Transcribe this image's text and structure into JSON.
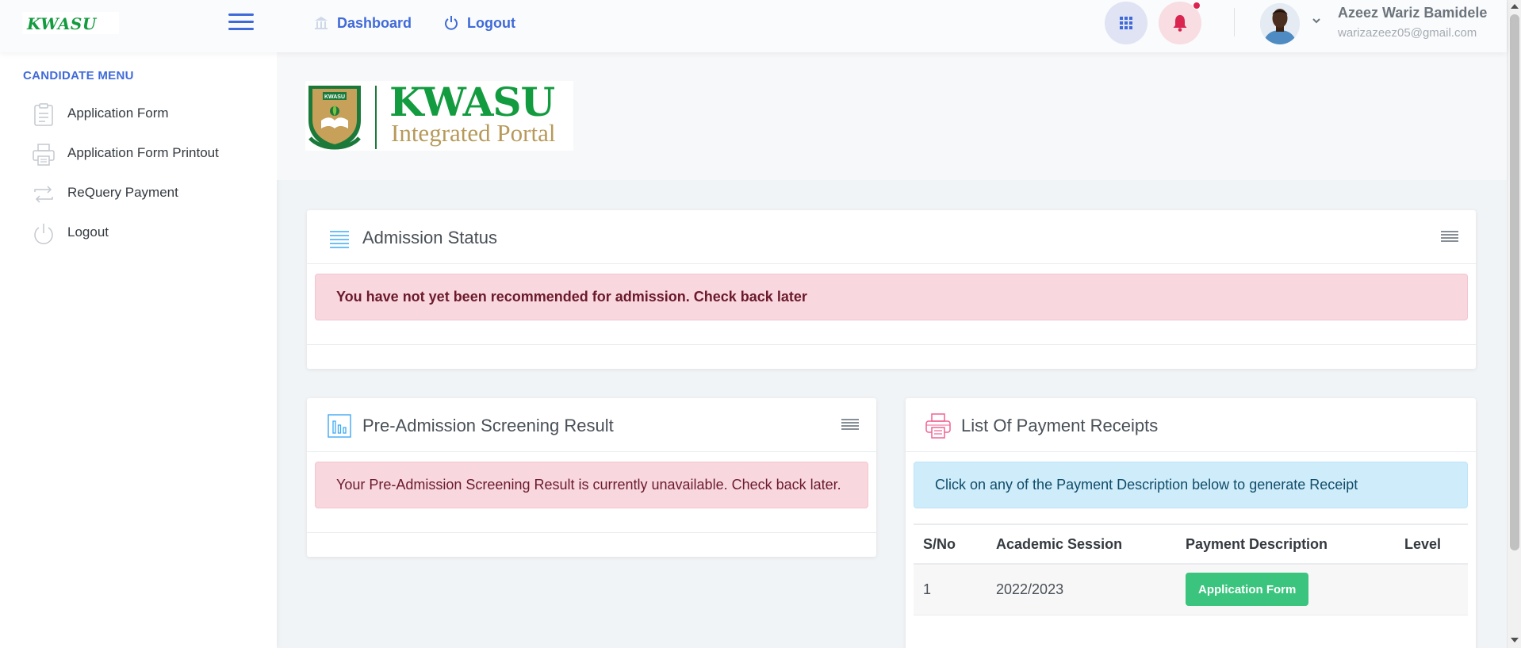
{
  "header": {
    "logo_text": "KWASU",
    "nav": [
      {
        "label": "Dashboard",
        "icon": "bank-icon"
      },
      {
        "label": "Logout",
        "icon": "power-icon"
      }
    ],
    "user": {
      "name": "Azeez Wariz Bamidele",
      "email": "warizazeez05@gmail.com"
    },
    "icons": [
      "hamburger-icon",
      "apps-grid-icon",
      "bell-icon",
      "chevron-down-icon"
    ],
    "accent_color": "#3f6ad8",
    "notification_color": "#d92550"
  },
  "sidebar": {
    "heading": "CANDIDATE MENU",
    "items": [
      {
        "label": "Application Form",
        "icon": "clipboard-icon"
      },
      {
        "label": "Application Form Printout",
        "icon": "printer-icon"
      },
      {
        "label": "ReQuery Payment",
        "icon": "repeat-icon"
      },
      {
        "label": "Logout",
        "icon": "power-icon"
      }
    ]
  },
  "banner": {
    "logo_title": "KWASU",
    "logo_subtitle": "Integrated Portal",
    "crest_text": "KWASU",
    "brand_green": "#139b3f",
    "brand_gold": "#b79a5a"
  },
  "admission_status": {
    "title": "Admission Status",
    "message": "You have not yet been recommended for admission. Check back later"
  },
  "screening": {
    "title": "Pre-Admission Screening Result",
    "message": "Your Pre-Admission Screening Result is currently unavailable. Check back later."
  },
  "payments": {
    "title": "List Of Payment Receipts",
    "info": "Click on any of the Payment Description below to generate Receipt",
    "columns": [
      "S/No",
      "Academic Session",
      "Payment Description",
      "Level"
    ],
    "rows": [
      {
        "sno": "1",
        "session": "2022/2023",
        "description": "Application Form",
        "level": ""
      }
    ]
  }
}
